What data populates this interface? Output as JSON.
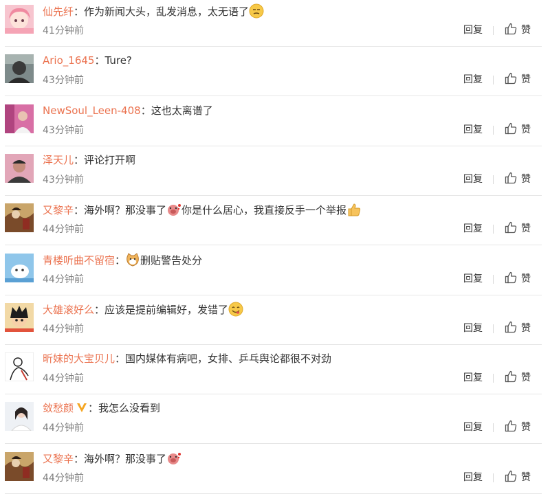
{
  "comments": [
    {
      "name": "仙先纤",
      "text_before": "作为新闻大头，乱发消息，太无语了",
      "emoji_mid": "",
      "text_after": "",
      "emoji_end": "unamused-face-emoji",
      "time": "41分钟前",
      "avatar": "pink-anime-girl"
    },
    {
      "name": "Ario_1645",
      "text_before": "Ture?",
      "emoji_mid": "",
      "text_after": "",
      "emoji_end": "",
      "time": "43分钟前",
      "avatar": "dark-portrait"
    },
    {
      "name": "NewSoul_Leen-408",
      "text_before": "这也太离谱了",
      "emoji_mid": "",
      "text_after": "",
      "emoji_end": "",
      "time": "43分钟前",
      "avatar": "pink-room"
    },
    {
      "name": "泽天儿",
      "text_before": "评论打开啊",
      "emoji_mid": "",
      "text_after": "",
      "emoji_end": "",
      "time": "43分钟前",
      "avatar": "man-cap"
    },
    {
      "name": "又黎辛",
      "text_before": "海外啊？那没事了",
      "emoji_mid": "pig-head-emoji",
      "text_after": "你是什么居心，我直接反手一个举报",
      "emoji_end": "thumbs-up-emoji",
      "time": "44分钟前",
      "avatar": "painting"
    },
    {
      "name": "青楼听曲不留宿",
      "text_before": "",
      "emoji_mid": "cat-emoji",
      "text_after": "删贴警告处分",
      "emoji_end": "",
      "time": "44分钟前",
      "avatar": "blue-sky-cartoon"
    },
    {
      "name": "大雄滚好么",
      "text_before": "应该是提前编辑好，发错了",
      "emoji_mid": "",
      "text_after": "",
      "emoji_end": "yum-face-emoji",
      "time": "44分钟前",
      "avatar": "anime-boy"
    },
    {
      "name": "昕妹的大宝贝儿",
      "text_before": "国内媒体有病吧，女排、乒乓舆论都很不对劲",
      "emoji_mid": "",
      "text_after": "",
      "emoji_end": "",
      "time": "44分钟前",
      "avatar": "sketch"
    },
    {
      "name": "敛愁颜",
      "vip": true,
      "text_before": "我怎么没看到",
      "emoji_mid": "",
      "text_after": "",
      "emoji_end": "",
      "time": "44分钟前",
      "avatar": "girl-photo"
    },
    {
      "name": "又黎辛",
      "text_before": "海外啊？那没事了",
      "emoji_mid": "",
      "text_after": "",
      "emoji_end": "pig-head-emoji",
      "time": "44分钟前",
      "avatar": "painting"
    }
  ],
  "actions": {
    "reply": "回复",
    "like": "赞"
  },
  "colon": "：",
  "colors": {
    "name": "#eb7350",
    "time": "#808080",
    "divider": "#e6e6e6",
    "vip_badge": "#f5a623"
  }
}
